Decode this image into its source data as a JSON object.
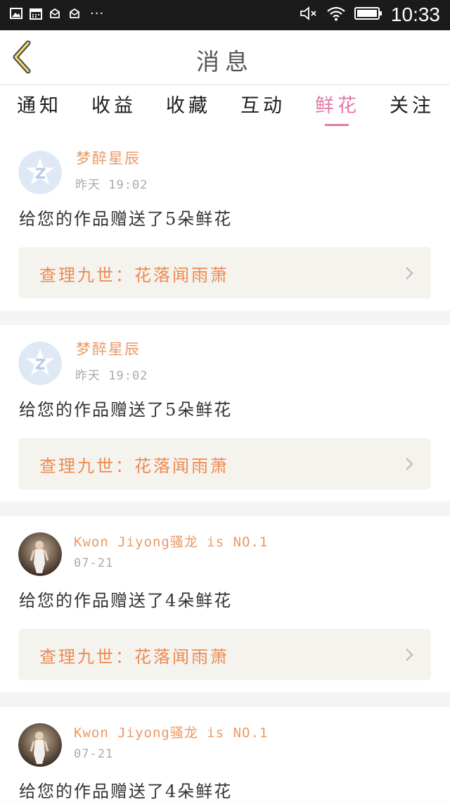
{
  "status_bar": {
    "time": "10:33",
    "left_icons": [
      "gallery-icon",
      "calendar-icon",
      "mail-icon",
      "mail-icon"
    ],
    "more": "···",
    "right_icons": [
      "mute-icon",
      "wifi-icon",
      "battery-icon"
    ]
  },
  "header": {
    "title": "消息",
    "back_icon": "chevron-left-icon"
  },
  "tabs": [
    {
      "label": "通知"
    },
    {
      "label": "收益"
    },
    {
      "label": "收藏"
    },
    {
      "label": "互动"
    },
    {
      "label": "鲜花",
      "active": true
    },
    {
      "label": "关注"
    }
  ],
  "colors": {
    "accent_pink": "#e57aa6",
    "name_orange": "#e99a63",
    "link_orange": "#ee8a52",
    "link_bg": "#f4f3ee"
  },
  "messages": [
    {
      "user": "梦醉星辰",
      "time": "昨天  19:02",
      "avatar": "default-qq-avatar-icon",
      "text": "给您的作品赠送了5朵鲜花",
      "work": "查理九世：花落闻雨萧"
    },
    {
      "user": "梦醉星辰",
      "time": "昨天  19:02",
      "avatar": "default-qq-avatar-icon",
      "text": "给您的作品赠送了5朵鲜花",
      "work": "查理九世：花落闻雨萧"
    },
    {
      "user": "Kwon Jiyong骚龙 is NO.1",
      "time": "07-21",
      "avatar": "user-photo",
      "text": "给您的作品赠送了4朵鲜花",
      "work": "查理九世：花落闻雨萧"
    },
    {
      "user": "Kwon Jiyong骚龙 is NO.1",
      "time": "07-21",
      "avatar": "user-photo",
      "text": "给您的作品赠送了4朵鲜花",
      "work": ""
    }
  ]
}
